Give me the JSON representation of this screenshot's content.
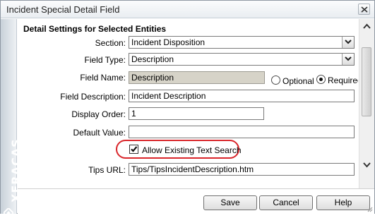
{
  "window": {
    "title": "Incident Special Detail Field"
  },
  "brand": {
    "name": "XFRACAS"
  },
  "form": {
    "heading": "Detail Settings for Selected Entities",
    "section": {
      "label": "Section:",
      "value": "Incident Disposition"
    },
    "field_type": {
      "label": "Field Type:",
      "value": "Description"
    },
    "field_name": {
      "label": "Field Name:",
      "value": "Description",
      "option_optional": "Optional",
      "option_required": "Required",
      "selected": "Required"
    },
    "field_description": {
      "label": "Field Description:",
      "value": "Incident Description"
    },
    "display_order": {
      "label": "Display Order:",
      "value": "1"
    },
    "default_value": {
      "label": "Default Value:",
      "value": ""
    },
    "allow_text_search": {
      "label": "Allow Existing Text Search",
      "checked": true
    },
    "tips_url": {
      "label": "Tips URL:",
      "value": "Tips/TipsIncidentDescription.htm"
    }
  },
  "buttons": {
    "save": "Save",
    "cancel": "Cancel",
    "help": "Help"
  }
}
